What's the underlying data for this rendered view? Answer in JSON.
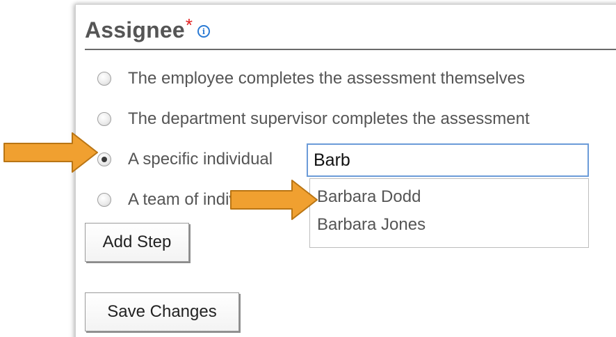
{
  "section": {
    "title": "Assignee",
    "required_mark": "*",
    "info_icon": "info-icon"
  },
  "assignee_options": [
    {
      "label": "The employee completes the assessment themselves",
      "selected": false
    },
    {
      "label": "The department supervisor completes the assessment",
      "selected": false
    },
    {
      "label": "A specific individual",
      "selected": true
    },
    {
      "label": "A team of individuals",
      "selected": false
    }
  ],
  "individual_search": {
    "value": "Barb"
  },
  "suggestions": [
    {
      "label": "Barbara Dodd"
    },
    {
      "label": "Barbara Jones"
    }
  ],
  "buttons": {
    "add_step": "Add Step",
    "save_changes": "Save Changes"
  },
  "colors": {
    "arrow": "#f0a030",
    "arrow_outline": "#b97514",
    "heading": "#555555",
    "required": "#e02020",
    "info": "#2a7ad4",
    "input_border": "#6b9bd8"
  }
}
